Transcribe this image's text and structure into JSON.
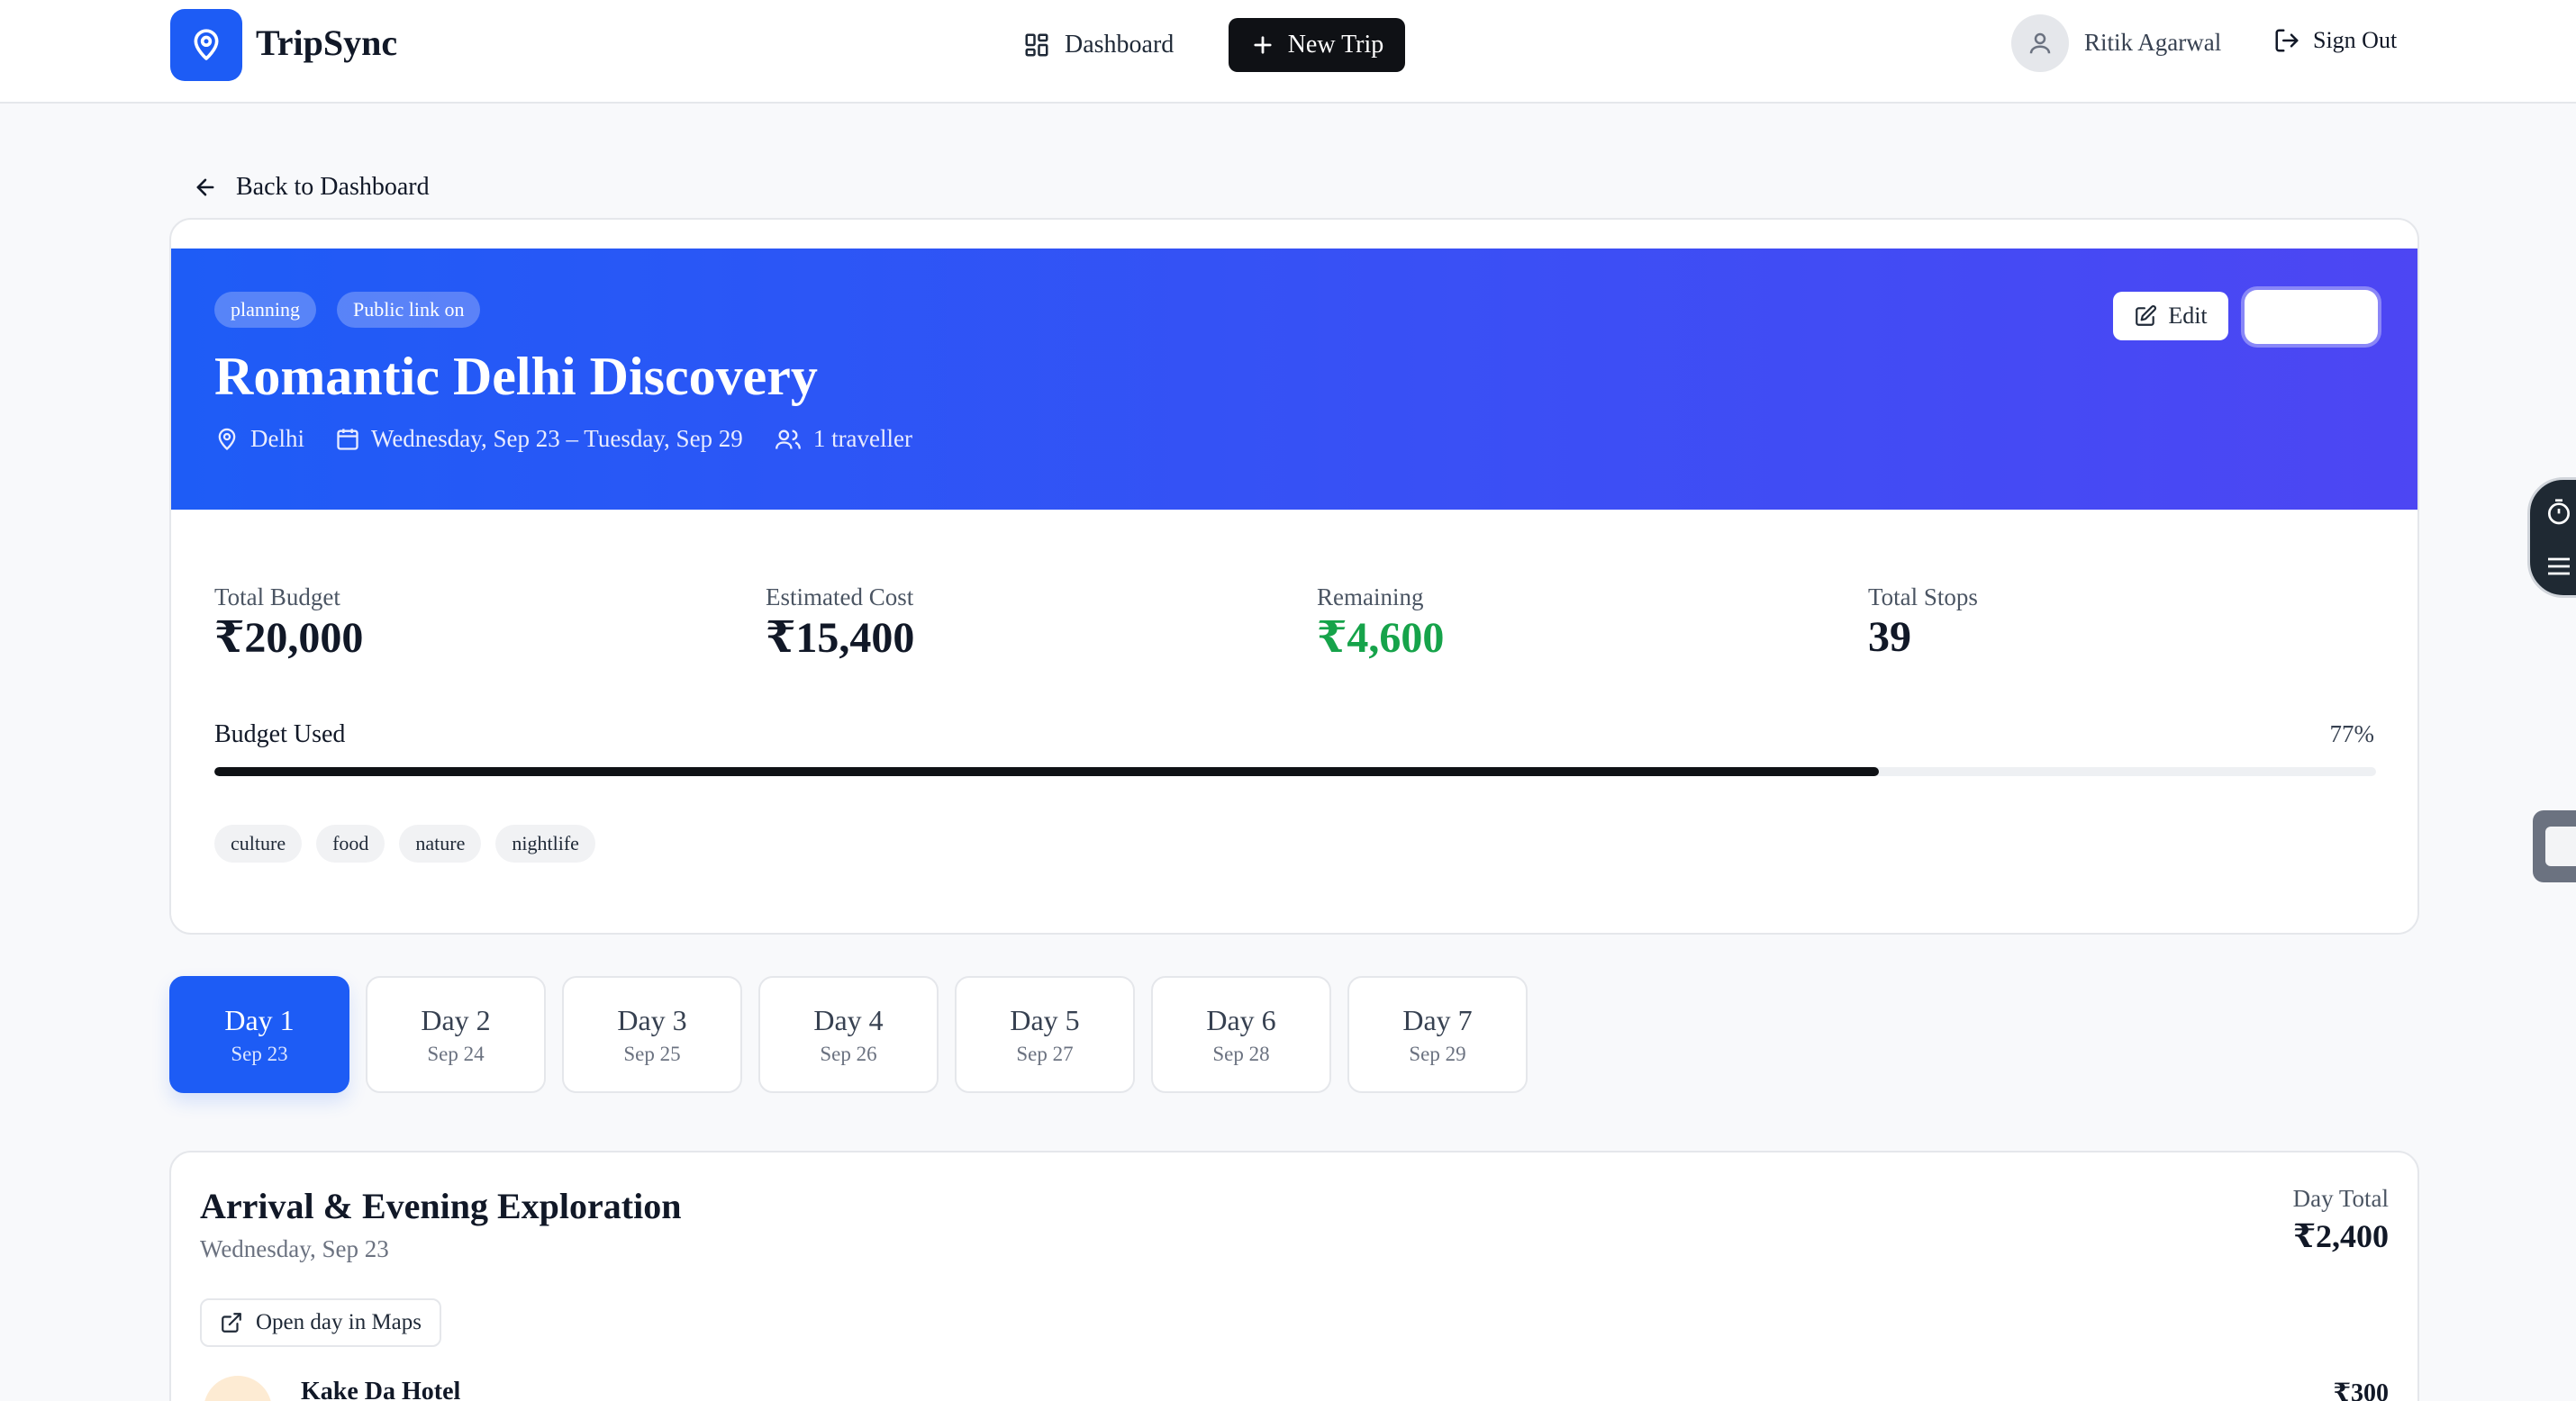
{
  "header": {
    "brand": "TripSync",
    "nav_dashboard": "Dashboard",
    "nav_new_trip": "New Trip",
    "user_name": "Ritik Agarwal",
    "sign_out": "Sign Out"
  },
  "back_link": "Back to Dashboard",
  "trip": {
    "status_pill": "planning",
    "public_pill": "Public link on",
    "title": "Romantic Delhi Discovery",
    "location": "Delhi",
    "dates": "Wednesday, Sep 23 – Tuesday, Sep 29",
    "travellers": "1 traveller",
    "edit_label": "Edit",
    "colors": {
      "hero_start": "#1e5cf6",
      "hero_end": "#4d46f3"
    }
  },
  "stats": {
    "total_budget_label": "Total Budget",
    "total_budget_value": "₹20,000",
    "estimated_cost_label": "Estimated Cost",
    "estimated_cost_value": "₹15,400",
    "remaining_label": "Remaining",
    "remaining_value": "₹4,600",
    "total_stops_label": "Total Stops",
    "total_stops_value": "39"
  },
  "budget": {
    "label": "Budget Used",
    "percent_text": "77%",
    "percent": 77
  },
  "tags": [
    "culture",
    "food",
    "nature",
    "nightlife"
  ],
  "days": [
    {
      "label": "Day 1",
      "date": "Sep 23",
      "active": true
    },
    {
      "label": "Day 2",
      "date": "Sep 24",
      "active": false
    },
    {
      "label": "Day 3",
      "date": "Sep 25",
      "active": false
    },
    {
      "label": "Day 4",
      "date": "Sep 26",
      "active": false
    },
    {
      "label": "Day 5",
      "date": "Sep 27",
      "active": false
    },
    {
      "label": "Day 6",
      "date": "Sep 28",
      "active": false
    },
    {
      "label": "Day 7",
      "date": "Sep 29",
      "active": false
    }
  ],
  "day_detail": {
    "title": "Arrival & Evening Exploration",
    "date": "Wednesday, Sep 23",
    "total_label": "Day Total",
    "total_value": "₹2,400",
    "maps_button": "Open day in Maps",
    "first_stop_name": "Kake Da Hotel",
    "first_stop_cost": "₹300"
  },
  "icons": {
    "logo": "map-pin-icon",
    "dashboard": "grid-icon",
    "new_trip": "plus-icon",
    "user": "user-icon",
    "sign_out": "logout-icon",
    "back": "arrow-left-icon",
    "location": "map-pin-icon",
    "calendar": "calendar-icon",
    "travellers": "users-icon",
    "edit": "edit-icon",
    "maps": "external-link-icon"
  }
}
